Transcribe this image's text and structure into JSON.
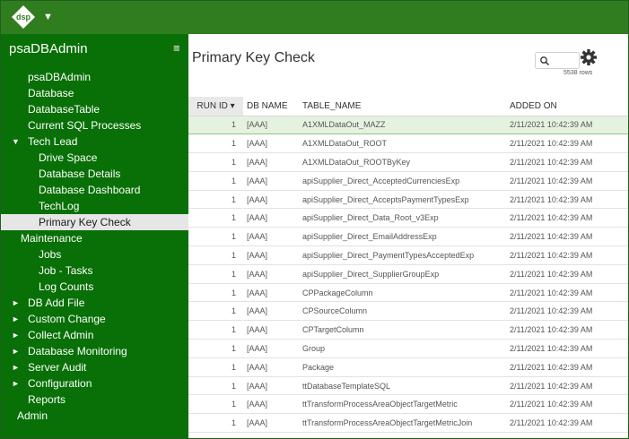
{
  "brand": {
    "logo_text": "dsp",
    "caret": "▼",
    "accent": "#2f7d1f",
    "sidebar_bg": "#087006"
  },
  "sidebar": {
    "title": "psaDBAdmin",
    "menu_icon": "hamburger-icon",
    "items": [
      {
        "label": "psaDBAdmin",
        "level": "l1",
        "arrow": ""
      },
      {
        "label": "Database",
        "level": "l1",
        "arrow": ""
      },
      {
        "label": "DatabaseTable",
        "level": "l1",
        "arrow": ""
      },
      {
        "label": "Current SQL Processes",
        "level": "l1",
        "arrow": ""
      },
      {
        "label": "Tech Lead",
        "level": "l1",
        "arrow": "▼"
      },
      {
        "label": "Drive Space",
        "level": "l2",
        "arrow": ""
      },
      {
        "label": "Database Details",
        "level": "l2",
        "arrow": ""
      },
      {
        "label": "Database Dashboard",
        "level": "l2",
        "arrow": ""
      },
      {
        "label": "TechLog",
        "level": "l2",
        "arrow": ""
      },
      {
        "label": "Primary Key Check",
        "level": "l2",
        "arrow": "",
        "active": true
      },
      {
        "label": "Maintenance",
        "level": "l0",
        "arrow": ""
      },
      {
        "label": "Jobs",
        "level": "l2",
        "arrow": ""
      },
      {
        "label": "Job - Tasks",
        "level": "l2",
        "arrow": ""
      },
      {
        "label": "Log Counts",
        "level": "l2",
        "arrow": ""
      },
      {
        "label": "DB Add File",
        "level": "l1",
        "arrow": "►"
      },
      {
        "label": "Custom Change",
        "level": "l1",
        "arrow": "►"
      },
      {
        "label": "Collect Admin",
        "level": "l1",
        "arrow": "►"
      },
      {
        "label": "Database Monitoring",
        "level": "l1",
        "arrow": "►"
      },
      {
        "label": "Server Audit",
        "level": "l1",
        "arrow": "►"
      },
      {
        "label": "Configuration",
        "level": "l1",
        "arrow": "►"
      },
      {
        "label": "Reports",
        "level": "l1",
        "arrow": ""
      },
      {
        "label": "Admin",
        "level": "l00",
        "arrow": ""
      }
    ]
  },
  "main": {
    "title": "Primary Key Check",
    "row_count": "5538 rows",
    "search_placeholder": "",
    "columns": [
      "RUN ID ▾",
      "DB NAME",
      "TABLE_NAME",
      "ADDED ON"
    ],
    "rows": [
      [
        "1",
        "[AAA]",
        "A1XMLDataOut_MAZZ",
        "2/11/2021 10:42:39 AM"
      ],
      [
        "1",
        "[AAA]",
        "A1XMLDataOut_ROOT",
        "2/11/2021 10:42:39 AM"
      ],
      [
        "1",
        "[AAA]",
        "A1XMLDataOut_ROOTByKey",
        "2/11/2021 10:42:39 AM"
      ],
      [
        "1",
        "[AAA]",
        "apiSupplier_Direct_AcceptedCurrenciesExp",
        "2/11/2021 10:42:39 AM"
      ],
      [
        "1",
        "[AAA]",
        "apiSupplier_Direct_AcceptsPaymentTypesExp",
        "2/11/2021 10:42:39 AM"
      ],
      [
        "1",
        "[AAA]",
        "apiSupplier_Direct_Data_Root_v3Exp",
        "2/11/2021 10:42:39 AM"
      ],
      [
        "1",
        "[AAA]",
        "apiSupplier_Direct_EmailAddressExp",
        "2/11/2021 10:42:39 AM"
      ],
      [
        "1",
        "[AAA]",
        "apiSupplier_Direct_PaymentTypesAcceptedExp",
        "2/11/2021 10:42:39 AM"
      ],
      [
        "1",
        "[AAA]",
        "apiSupplier_Direct_SupplierGroupExp",
        "2/11/2021 10:42:39 AM"
      ],
      [
        "1",
        "[AAA]",
        "CPPackageColumn",
        "2/11/2021 10:42:39 AM"
      ],
      [
        "1",
        "[AAA]",
        "CPSourceColumn",
        "2/11/2021 10:42:39 AM"
      ],
      [
        "1",
        "[AAA]",
        "CPTargetColumn",
        "2/11/2021 10:42:39 AM"
      ],
      [
        "1",
        "[AAA]",
        "Group",
        "2/11/2021 10:42:39 AM"
      ],
      [
        "1",
        "[AAA]",
        "Package",
        "2/11/2021 10:42:39 AM"
      ],
      [
        "1",
        "[AAA]",
        "ttDatabaseTemplateSQL",
        "2/11/2021 10:42:39 AM"
      ],
      [
        "1",
        "[AAA]",
        "ttTransformProcessAreaObjectTargetMetric",
        "2/11/2021 10:42:39 AM"
      ],
      [
        "1",
        "[AAA]",
        "ttTransformProcessAreaObjectTargetMetricJoin",
        "2/11/2021 10:42:39 AM"
      ]
    ]
  }
}
